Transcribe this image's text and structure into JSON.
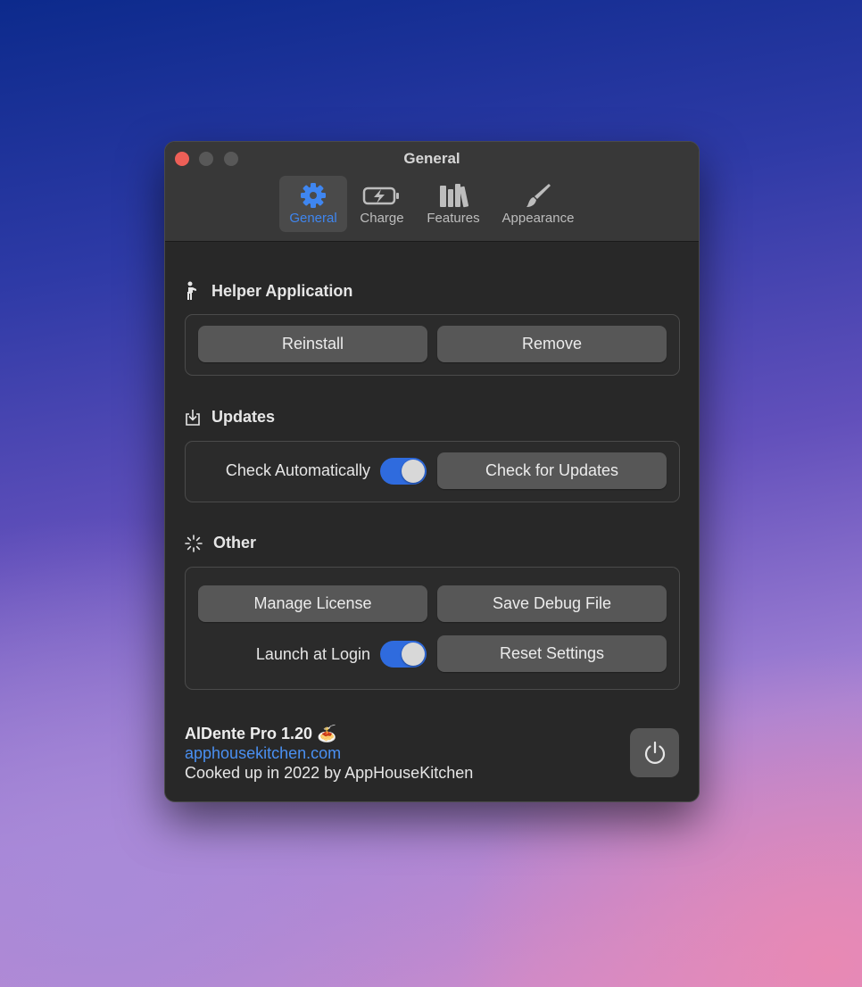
{
  "window": {
    "title": "General"
  },
  "tabs": [
    {
      "label": "General",
      "icon": "gear-icon",
      "active": true
    },
    {
      "label": "Charge",
      "icon": "battery-charging-icon",
      "active": false
    },
    {
      "label": "Features",
      "icon": "books-icon",
      "active": false
    },
    {
      "label": "Appearance",
      "icon": "paintbrush-icon",
      "active": false
    }
  ],
  "helper": {
    "title": "Helper Application",
    "icon": "figure-standing-icon",
    "reinstall_label": "Reinstall",
    "remove_label": "Remove"
  },
  "updates": {
    "title": "Updates",
    "icon": "tray-download-icon",
    "check_auto_label": "Check Automatically",
    "check_auto_on": true,
    "check_button_label": "Check for Updates"
  },
  "other": {
    "title": "Other",
    "icon": "progress-spinner-icon",
    "manage_license_label": "Manage License",
    "save_debug_label": "Save Debug File",
    "launch_login_label": "Launch at Login",
    "launch_login_on": true,
    "reset_settings_label": "Reset Settings"
  },
  "footer": {
    "app_name": "AlDente Pro 1.20 🍝",
    "link": "apphousekitchen.com",
    "credit": "Cooked up in 2022 by AppHouseKitchen",
    "power_icon": "power-icon"
  },
  "colors": {
    "accent": "#2f6bde",
    "active_tab": "#3f86f0",
    "link": "#4a90f2",
    "close": "#ed5f57"
  }
}
